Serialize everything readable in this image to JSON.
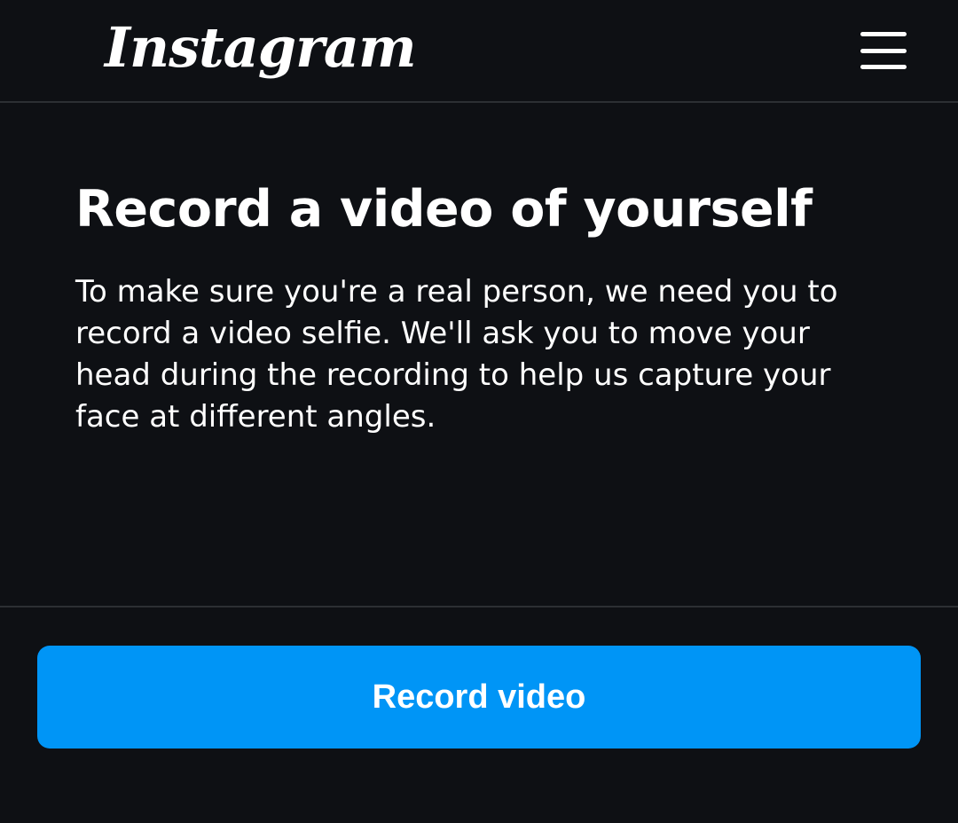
{
  "header": {
    "logo_text": "Instagram",
    "menu_icon": "hamburger-menu-icon"
  },
  "main": {
    "title": "Record a video of yourself",
    "description": "To make sure you're a real person, we need you to record a video selfie. We'll ask you to move your head during the recording to help us capture your face at different angles."
  },
  "footer": {
    "record_button_label": "Record video"
  },
  "colors": {
    "background": "#0e1014",
    "accent": "#0095f6",
    "divider": "#2c2f33",
    "text": "#ffffff"
  }
}
